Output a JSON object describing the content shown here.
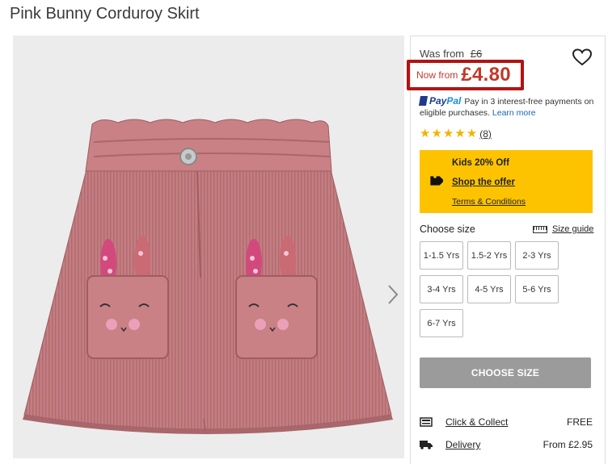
{
  "product": {
    "title": "Pink Bunny Corduroy Skirt"
  },
  "price": {
    "was_label": "Was from",
    "was_value": "£6",
    "now_label": "Now from",
    "now_value": "£4.80"
  },
  "paypal": {
    "brand1": "Pay",
    "brand2": "Pal",
    "text": "Pay in 3 interest-free payments on eligible purchases.",
    "learn_more": "Learn more"
  },
  "rating": {
    "stars": "★★★★★",
    "count": "(8)"
  },
  "promo": {
    "title": "Kids 20% Off",
    "shop": "Shop the offer",
    "terms": "Terms & Conditions",
    "icon": "price-tag-icon"
  },
  "size": {
    "label": "Choose size",
    "guide": "Size guide",
    "options": [
      "1-1.5 Yrs",
      "1.5-2 Yrs",
      "2-3 Yrs",
      "3-4 Yrs",
      "4-5 Yrs",
      "5-6 Yrs",
      "6-7 Yrs"
    ]
  },
  "cta": {
    "choose_size": "CHOOSE SIZE"
  },
  "delivery": [
    {
      "label": "Click & Collect",
      "price": "FREE",
      "icon": "store-icon"
    },
    {
      "label": "Delivery",
      "price": "From £2.95",
      "icon": "truck-icon"
    }
  ],
  "colors": {
    "sale_red": "#c0392b",
    "highlight_border": "#b31313",
    "promo_yellow": "#fdc300",
    "button_grey": "#9b9b9b",
    "star_gold": "#f0b400"
  }
}
